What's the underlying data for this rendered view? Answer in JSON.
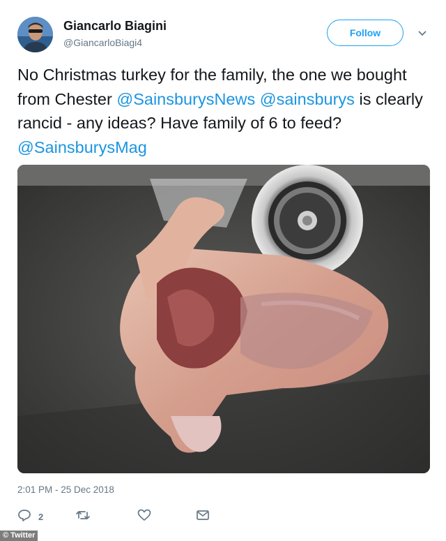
{
  "author": {
    "display_name": "Giancarlo Biagini",
    "handle": "@GiancarloBiagi4"
  },
  "follow_label": "Follow",
  "tweet": {
    "segments": [
      {
        "text": "No Christmas turkey for the family, the one we bought from Chester ",
        "type": "text"
      },
      {
        "text": "@SainsburysNews",
        "type": "mention"
      },
      {
        "text": " ",
        "type": "text"
      },
      {
        "text": "@sainsburys",
        "type": "mention"
      },
      {
        "text": " is clearly rancid - any ideas? Have family of 6 to feed? ",
        "type": "text"
      },
      {
        "text": "@SainsburysMag",
        "type": "mention"
      }
    ]
  },
  "timestamp": "2:01 PM - 25 Dec 2018",
  "actions": {
    "reply_count": "2"
  },
  "watermark": "© Twitter",
  "colors": {
    "accent": "#1da1f2",
    "mention": "#1b95e0",
    "muted": "#657786"
  },
  "icons": [
    "chevron-down-icon",
    "reply-icon",
    "retweet-icon",
    "like-icon",
    "message-icon"
  ]
}
